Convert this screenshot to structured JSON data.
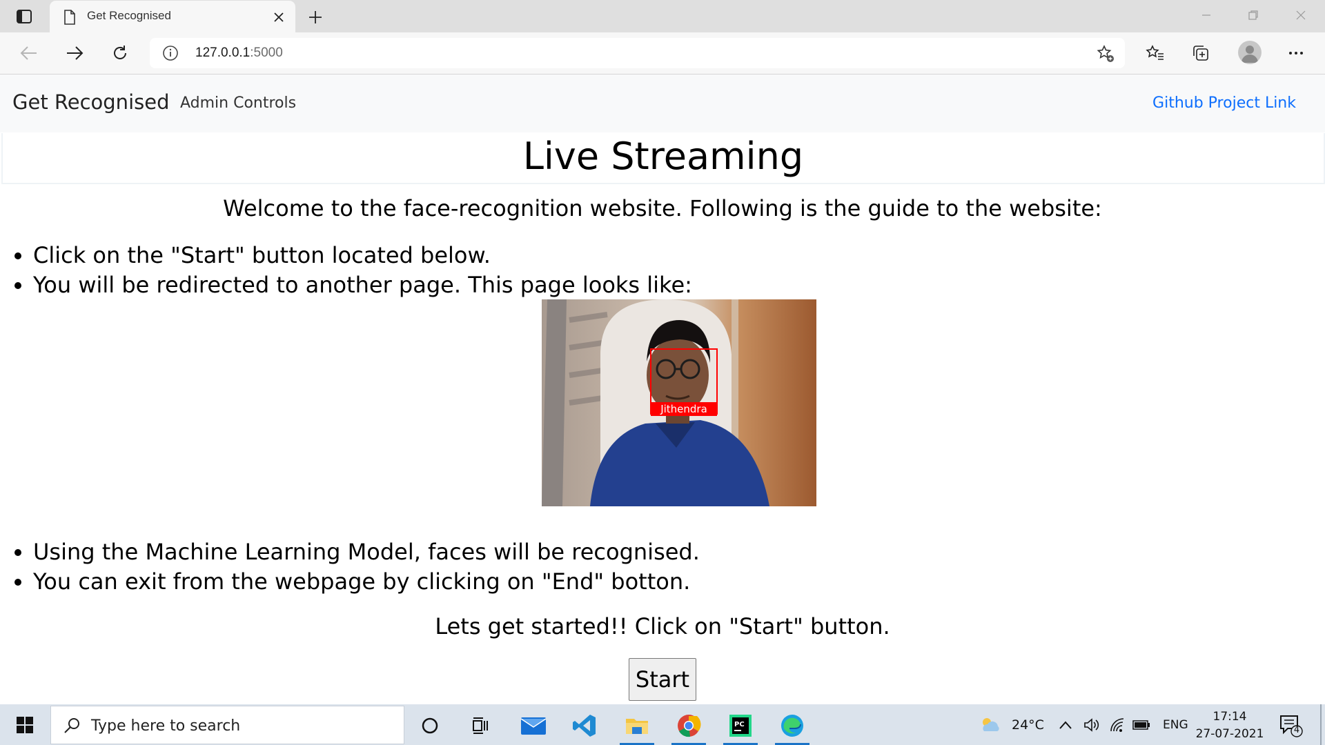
{
  "browser": {
    "tab_title": "Get Recognised",
    "url_host": "127.0.0.1",
    "url_port": ":5000"
  },
  "site": {
    "brand": "Get Recognised",
    "nav_admin": "Admin Controls",
    "nav_github": "Github Project Link"
  },
  "page": {
    "heading": "Live Streaming",
    "welcome": "Welcome to the face-recognition website. Following is the guide to the website:",
    "steps_top": [
      "Click on the \"Start\" button located below.",
      "You will be redirected to another page. This page looks like:"
    ],
    "image_label": "Jithendra",
    "steps_bottom": [
      "Using the Machine Learning Model, faces will be recognised.",
      "You can exit from the webpage by clicking on \"End\" botton."
    ],
    "outro": "Lets get started!! Click on \"Start\" button.",
    "start_label": "Start"
  },
  "taskbar": {
    "search_placeholder": "Type here to search",
    "weather_temp": "24°C",
    "language": "ENG",
    "time": "17:14",
    "date": "27-07-2021",
    "notification_count": "4",
    "apps": [
      "cortana-icon",
      "task-view-icon",
      "mail-icon",
      "vscode-icon",
      "file-explorer-icon",
      "chrome-icon",
      "pycharm-icon",
      "edge-icon"
    ]
  },
  "colors": {
    "link": "#0d6efd",
    "label_box": "#ff0000",
    "taskbar": "#dbe3ec"
  }
}
